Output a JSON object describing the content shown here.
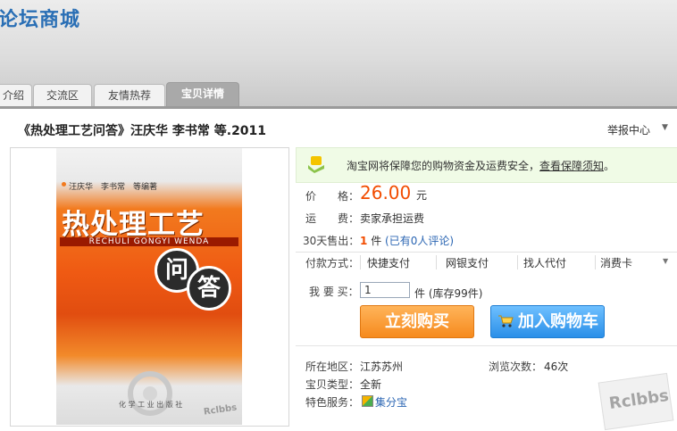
{
  "header": {
    "site_title": "论坛商城",
    "tabs": [
      {
        "label": "介绍"
      },
      {
        "label": "交流区"
      },
      {
        "label": "友情热荐"
      },
      {
        "label": "宝贝详情",
        "active": true
      }
    ]
  },
  "product": {
    "title": "《热处理工艺问答》汪庆华 李书常 等.2011",
    "report_label": "举报中心"
  },
  "cover": {
    "authors": "汪庆华　李书常　等编著",
    "title": "热处理工艺",
    "pinyin": "RECHULI GONGYI WENDA",
    "char1": "问",
    "char2": "答",
    "publisher": "化 学 工 业 出 版 社"
  },
  "watermark": "Rclbbs",
  "security": {
    "text": "淘宝网将保障您的购物资金及运费安全，",
    "link": "查看保障须知",
    "tail": "。"
  },
  "price": {
    "label": "价　　格：",
    "value": "26.00",
    "unit": "元"
  },
  "shipping": {
    "label": "运　　费：",
    "value": "卖家承担运费"
  },
  "sales": {
    "label": "30天售出：",
    "count": "1",
    "unit": "件",
    "reviews": "(已有0人评论)"
  },
  "payment": {
    "label": "付款方式：",
    "options": [
      "快捷支付",
      "网银支付",
      "找人代付",
      "消费卡"
    ]
  },
  "buy": {
    "qty_label": "我 要 买：",
    "qty_value": "1",
    "stock": "件 (库存99件)",
    "buy_now": "立刻购买",
    "add_cart": "加入购物车"
  },
  "details": {
    "location_label": "所在地区：",
    "location": "江苏苏州",
    "views_label": "浏览次数：",
    "views": "46次",
    "type_label": "宝贝类型：",
    "type": "全新",
    "service_label": "特色服务：",
    "service": "集分宝"
  },
  "colors": {
    "price": "#f24c00",
    "link": "#2b66b3",
    "buy": "#f68a1d",
    "cart": "#2a8fe8"
  }
}
